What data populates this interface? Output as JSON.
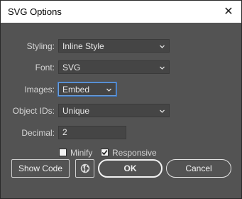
{
  "window": {
    "title": "SVG Options",
    "close_glyph": "✕"
  },
  "form": {
    "styling": {
      "label": "Styling:",
      "value": "Inline Style"
    },
    "font": {
      "label": "Font:",
      "value": "SVG"
    },
    "images": {
      "label": "Images:",
      "value": "Embed"
    },
    "object_ids": {
      "label": "Object IDs:",
      "value": "Unique"
    },
    "decimal": {
      "label": "Decimal:",
      "value": "2"
    }
  },
  "options": {
    "minify": {
      "label": "Minify",
      "checked": false
    },
    "responsive": {
      "label": "Responsive",
      "checked": true
    }
  },
  "buttons": {
    "show_code": "Show Code",
    "ok": "OK",
    "cancel": "Cancel"
  },
  "icons": {
    "browser": "globe-icon",
    "dropdown": "chevron-down-icon",
    "check": "checkmark-icon",
    "close": "close-icon"
  }
}
